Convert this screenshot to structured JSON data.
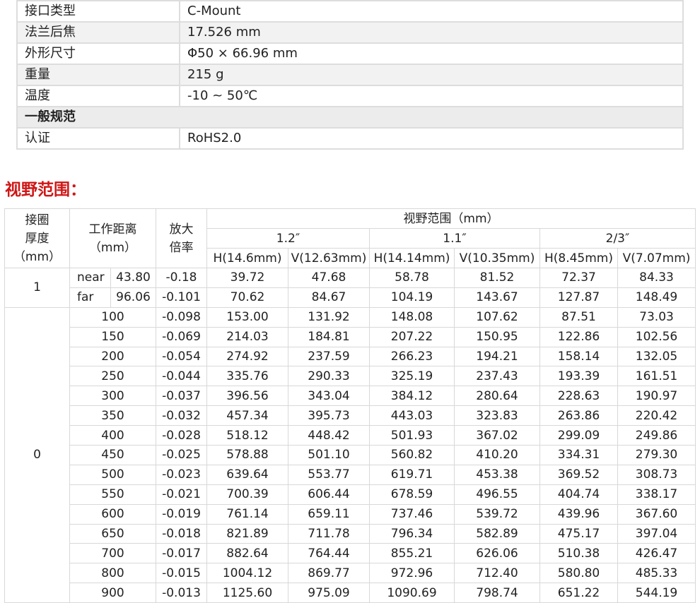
{
  "spec_rows": [
    {
      "key": "接口类型",
      "value": "C-Mount",
      "shade": false
    },
    {
      "key": "法兰后焦",
      "value": "17.526 mm",
      "shade": true
    },
    {
      "key": "外形尺寸",
      "value": "Φ50 × 66.96 mm",
      "shade": false
    },
    {
      "key": "重量",
      "value": "215 g",
      "shade": true
    },
    {
      "key": "温度",
      "value": "-10 ~ 50℃",
      "shade": false
    }
  ],
  "spec_section": "一般规范",
  "spec_cert": {
    "key": "认证",
    "value": "RoHS2.0"
  },
  "fov_title": "视野范围：",
  "fov_header": {
    "ring": "接圈厚度（mm）",
    "ring_l1": "接圈",
    "ring_l2": "厚度",
    "ring_l3": "（mm）",
    "wd_l1": "工作距离",
    "wd_l2": "（mm）",
    "mag_l1": "放大",
    "mag_l2": "倍率",
    "fov": "视野范围（mm）",
    "sensors": [
      "1.2″",
      "1.1″",
      "2/3″"
    ],
    "cols": [
      "H(14.6mm)",
      "V(12.63mm)",
      "H(14.14mm)",
      "V(10.35mm)",
      "H(8.45mm)",
      "V(7.07mm)"
    ]
  },
  "ring1": {
    "label": "1",
    "rows": [
      {
        "wd_tag": "near",
        "wd": "43.80",
        "mag": "-0.18",
        "v": [
          "39.72",
          "47.68",
          "58.78",
          "81.52",
          "72.37",
          "84.33"
        ]
      },
      {
        "wd_tag": "far",
        "wd": "96.06",
        "mag": "-0.101",
        "v": [
          "70.62",
          "84.67",
          "104.19",
          "143.67",
          "127.87",
          "148.49"
        ]
      }
    ]
  },
  "ring0": {
    "label": "0",
    "rows": [
      {
        "wd": "100",
        "mag": "-0.098",
        "v": [
          "153.00",
          "131.92",
          "148.08",
          "107.62",
          "87.51",
          "73.03"
        ]
      },
      {
        "wd": "150",
        "mag": "-0.069",
        "v": [
          "214.03",
          "184.81",
          "207.22",
          "150.95",
          "122.86",
          "102.56"
        ]
      },
      {
        "wd": "200",
        "mag": "-0.054",
        "v": [
          "274.92",
          "237.59",
          "266.23",
          "194.21",
          "158.14",
          "132.05"
        ]
      },
      {
        "wd": "250",
        "mag": "-0.044",
        "v": [
          "335.76",
          "290.33",
          "325.19",
          "237.43",
          "193.39",
          "161.51"
        ]
      },
      {
        "wd": "300",
        "mag": "-0.037",
        "v": [
          "396.56",
          "343.04",
          "384.12",
          "280.64",
          "228.63",
          "190.97"
        ]
      },
      {
        "wd": "350",
        "mag": "-0.032",
        "v": [
          "457.34",
          "395.73",
          "443.03",
          "323.83",
          "263.86",
          "220.42"
        ]
      },
      {
        "wd": "400",
        "mag": "-0.028",
        "v": [
          "518.12",
          "448.42",
          "501.93",
          "367.02",
          "299.09",
          "249.86"
        ]
      },
      {
        "wd": "450",
        "mag": "-0.025",
        "v": [
          "578.88",
          "501.10",
          "560.82",
          "410.20",
          "334.31",
          "279.30"
        ]
      },
      {
        "wd": "500",
        "mag": "-0.023",
        "v": [
          "639.64",
          "553.77",
          "619.71",
          "453.38",
          "369.52",
          "308.73"
        ]
      },
      {
        "wd": "550",
        "mag": "-0.021",
        "v": [
          "700.39",
          "606.44",
          "678.59",
          "496.55",
          "404.74",
          "338.17"
        ]
      },
      {
        "wd": "600",
        "mag": "-0.019",
        "v": [
          "761.14",
          "659.11",
          "737.46",
          "539.72",
          "439.96",
          "367.60"
        ]
      },
      {
        "wd": "650",
        "mag": "-0.018",
        "v": [
          "821.89",
          "711.78",
          "796.34",
          "582.89",
          "475.17",
          "397.04"
        ]
      },
      {
        "wd": "700",
        "mag": "-0.017",
        "v": [
          "882.64",
          "764.44",
          "855.21",
          "626.06",
          "510.38",
          "426.47"
        ]
      },
      {
        "wd": "800",
        "mag": "-0.015",
        "v": [
          "1004.12",
          "869.77",
          "972.96",
          "712.40",
          "580.80",
          "485.33"
        ]
      },
      {
        "wd": "900",
        "mag": "-0.013",
        "v": [
          "1125.60",
          "975.09",
          "1090.69",
          "798.74",
          "651.22",
          "544.19"
        ]
      }
    ]
  }
}
